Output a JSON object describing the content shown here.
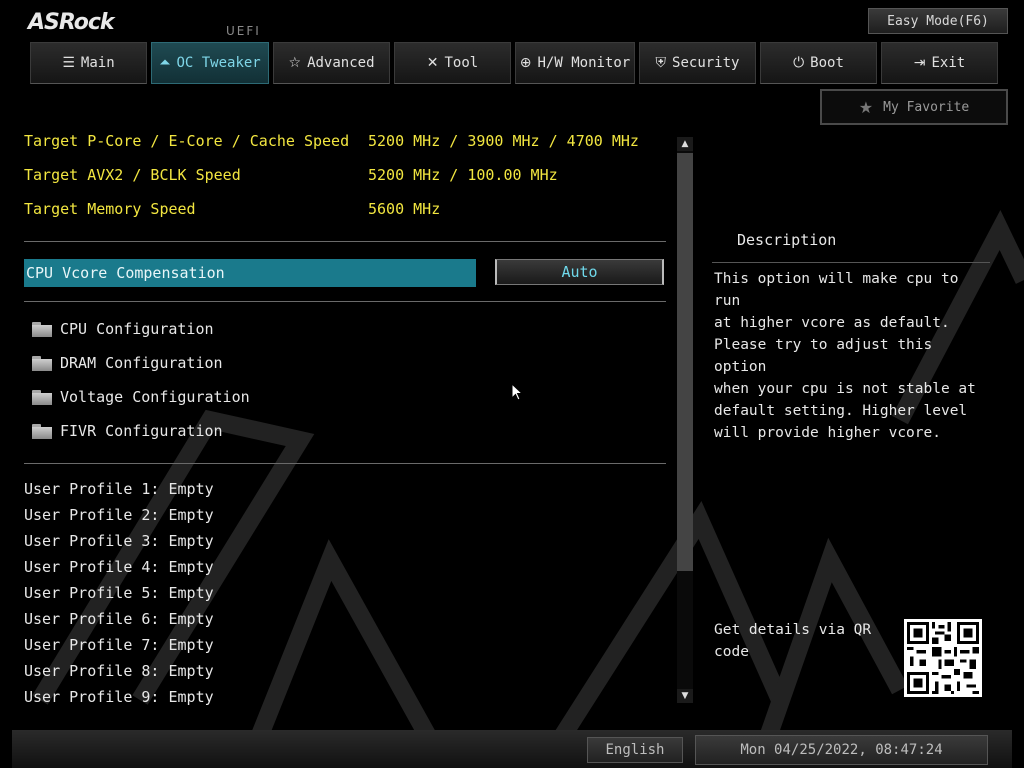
{
  "header": {
    "logo": "ASRock",
    "uefi_label": "UEFI",
    "easy_mode_label": "Easy Mode(F6)"
  },
  "tabs": [
    {
      "label": "Main",
      "icon": "list-icon"
    },
    {
      "label": "OC Tweaker",
      "icon": "rocket-icon",
      "active": true
    },
    {
      "label": "Advanced",
      "icon": "star-outline-icon"
    },
    {
      "label": "Tool",
      "icon": "tools-icon"
    },
    {
      "label": "H/W Monitor",
      "icon": "monitor-globe-icon"
    },
    {
      "label": "Security",
      "icon": "shield-icon"
    },
    {
      "label": "Boot",
      "icon": "power-icon"
    },
    {
      "label": "Exit",
      "icon": "exit-door-icon"
    }
  ],
  "favorite_label": "My Favorite",
  "info": [
    {
      "label": "Target P-Core / E-Core / Cache Speed",
      "value": "5200 MHz / 3900 MHz / 4700 MHz"
    },
    {
      "label": "Target AVX2 / BCLK Speed",
      "value": "5200 MHz / 100.00 MHz"
    },
    {
      "label": "Target Memory Speed",
      "value": "5600 MHz"
    }
  ],
  "selected_option": {
    "label": "CPU Vcore Compensation",
    "value": "Auto"
  },
  "folders": [
    "CPU Configuration",
    "DRAM Configuration",
    "Voltage Configuration",
    "FIVR Configuration"
  ],
  "profiles": [
    "User Profile 1: Empty",
    "User Profile 2: Empty",
    "User Profile 3: Empty",
    "User Profile 4: Empty",
    "User Profile 5: Empty",
    "User Profile 6: Empty",
    "User Profile 7: Empty",
    "User Profile 8: Empty",
    "User Profile 9: Empty"
  ],
  "description": {
    "title": "Description",
    "text": "This option will make cpu to run\nat higher vcore as default.\nPlease try to adjust this option\nwhen your cpu is not stable at\ndefault setting. Higher level\nwill provide higher vcore.",
    "qr_label": "Get details via QR code"
  },
  "footer": {
    "language": "English",
    "datetime": "Mon 04/25/2022, 08:47:24"
  },
  "colors": {
    "highlight": "#1a7a8c",
    "info_text": "#f2e640",
    "active_tab_text": "#7fd6e8"
  }
}
